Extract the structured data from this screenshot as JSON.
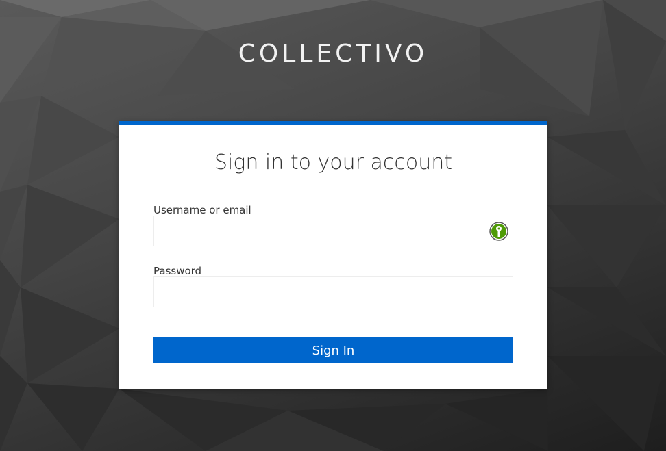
{
  "brand": {
    "title": "COLLECTIVO"
  },
  "login": {
    "heading": "Sign in to your account",
    "username_label": "Username or email",
    "username_value": "",
    "password_label": "Password",
    "password_value": "",
    "submit_label": "Sign In"
  },
  "icons": {
    "username_field_icon": "keepassxc-icon"
  },
  "colors": {
    "accent": "#0066cc",
    "card_background": "#ffffff",
    "page_background": "#3a3a3a",
    "icon_green": "#4e9a06"
  }
}
